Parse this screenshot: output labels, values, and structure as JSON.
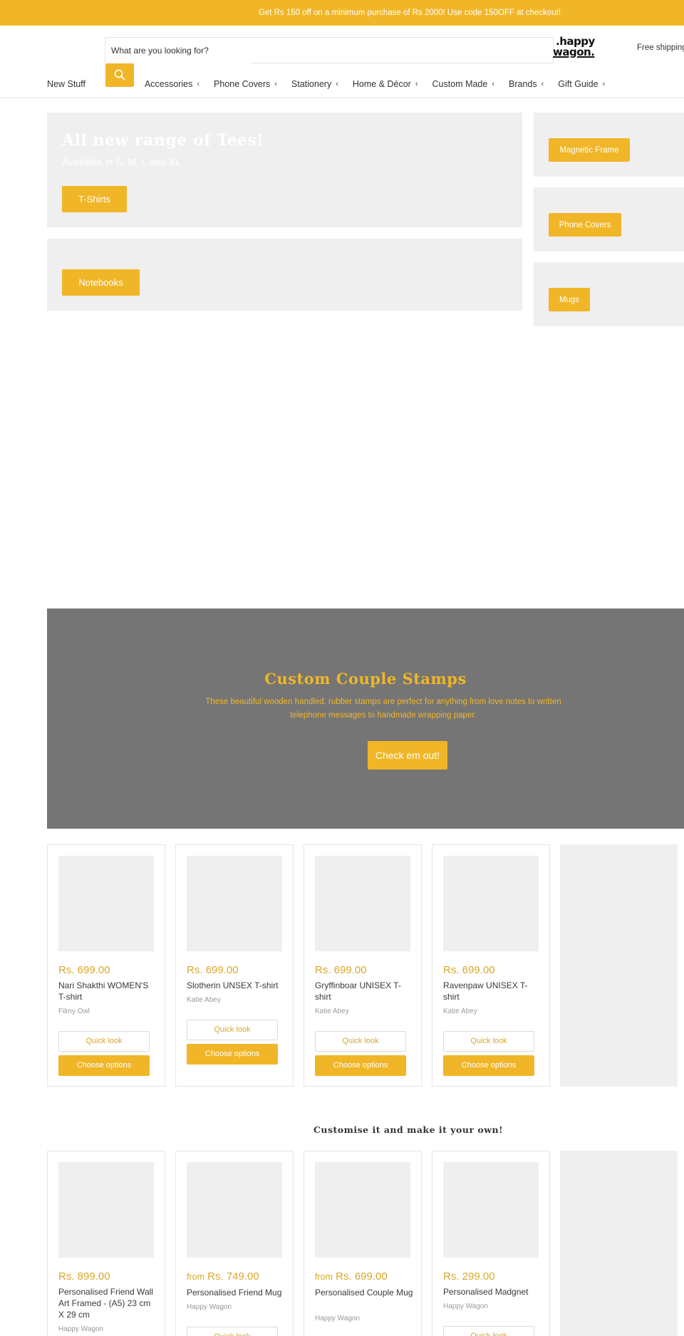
{
  "announcement": "Get Rs 150 off on a minimum purchase of Rs 2000! Use code 150OFF at checkout!",
  "header": {
    "search_placeholder": "What are you looking for?",
    "logo_line1": ".happy",
    "logo_line2": "wagon.",
    "free_shipping": "Free shipping"
  },
  "nav": [
    {
      "label": "New Stuff",
      "has_chevron": false
    },
    {
      "label": "Accessories",
      "has_chevron": true
    },
    {
      "label": "Phone Covers",
      "has_chevron": true
    },
    {
      "label": "Stationery",
      "has_chevron": true
    },
    {
      "label": "Home & Décor",
      "has_chevron": true
    },
    {
      "label": "Custom Made",
      "has_chevron": true
    },
    {
      "label": "Brands",
      "has_chevron": true
    },
    {
      "label": "Gift Guide",
      "has_chevron": true
    }
  ],
  "chevron_glyph": "‹",
  "hero": {
    "title": "All new range of Tees!",
    "subtitle": "Available in S, M, L and XL",
    "button": "T-Shirts"
  },
  "tiles": {
    "notebooks": "Notebooks",
    "magnetic_frame": "Magnetic Frame",
    "phone_covers": "Phone Covers",
    "mugs": "Mugs"
  },
  "promo": {
    "title": "Custom Couple Stamps",
    "text": "These beautiful wooden handled, rubber stamps are perfect for anything from love notes to written telephone messages to handmade wrapping paper.",
    "button": "Check em out!"
  },
  "buttons": {
    "quick_look": "Quick look",
    "choose_options": "Choose options"
  },
  "products_row1": [
    {
      "from": "",
      "price": "Rs. 699.00",
      "title": "Nari Shakthi WOMEN'S T-shirt",
      "vendor": "Filmy Owl"
    },
    {
      "from": "",
      "price": "Rs. 699.00",
      "title": "Slotherin UNSEX T-shirt",
      "vendor": "Katie Abey"
    },
    {
      "from": "",
      "price": "Rs. 699.00",
      "title": "Gryffinboar UNISEX T-shirt",
      "vendor": "Katie Abey"
    },
    {
      "from": "",
      "price": "Rs. 699.00",
      "title": "Ravenpaw UNISEX T-shirt",
      "vendor": "Katie Abey"
    }
  ],
  "section2_title": "Customise it and make it your own!",
  "products_row2": [
    {
      "from": "",
      "price": "Rs. 899.00",
      "title": "Personalised Friend Wall Art Framed - (A5) 23 cm X 29 cm",
      "vendor": "Happy Wagon"
    },
    {
      "from": "from",
      "price": "Rs. 749.00",
      "title": "Personalised Friend Mug",
      "vendor": "Happy Wagon"
    },
    {
      "from": "from",
      "price": "Rs. 699.00",
      "title": "Personalised Couple Mug",
      "vendor": "Happy Wagon"
    },
    {
      "from": "",
      "price": "Rs. 299.00",
      "title": "Personalised Madgnet",
      "vendor": "Happy Wagon"
    }
  ],
  "colors": {
    "brand_yellow": "#f0b628",
    "price_gold": "#d9a82a",
    "tile_gray": "#efefef",
    "promo_gray": "#757575"
  }
}
